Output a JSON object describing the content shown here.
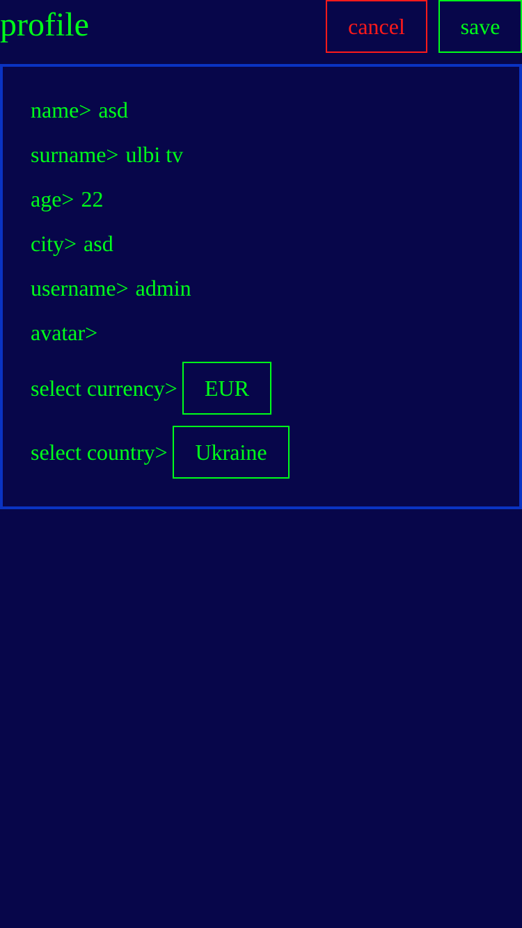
{
  "header": {
    "title": "profile",
    "cancel_label": "cancel",
    "save_label": "save"
  },
  "form": {
    "fields": [
      {
        "label": "name>",
        "value": "asd"
      },
      {
        "label": "surname>",
        "value": "ulbi tv"
      },
      {
        "label": "age>",
        "value": "22"
      },
      {
        "label": "city>",
        "value": "asd"
      },
      {
        "label": "username>",
        "value": "admin"
      },
      {
        "label": "avatar>",
        "value": ""
      }
    ],
    "currency": {
      "label": "select currency>",
      "selected": "EUR"
    },
    "country": {
      "label": "select country>",
      "selected": "Ukraine"
    }
  },
  "colors": {
    "background": "#07064a",
    "text": "#00ff1a",
    "cancel": "#ff1a1a",
    "card_border": "#0a33c2"
  }
}
